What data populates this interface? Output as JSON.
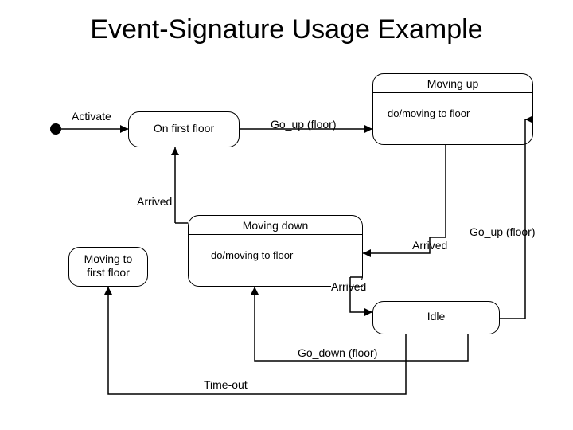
{
  "title": "Event-Signature Usage Example",
  "states": {
    "moving_up": {
      "name": "Moving up",
      "activity": "do/moving to floor"
    },
    "on_first_floor": {
      "name": "On first floor"
    },
    "moving_down": {
      "name": "Moving down",
      "activity": "do/moving to floor"
    },
    "moving_to_first_floor": {
      "name_l1": "Moving to",
      "name_l2": "first floor"
    },
    "idle": {
      "name": "Idle"
    }
  },
  "transitions": {
    "activate": "Activate",
    "go_up_floor_1": "Go_up (floor)",
    "arrived_1": "Arrived",
    "arrived_2": "Arrived",
    "arrived_3": "Arrived",
    "go_up_floor_2": "Go_up (floor)",
    "go_down_floor": "Go_down (floor)",
    "time_out": "Time-out"
  }
}
